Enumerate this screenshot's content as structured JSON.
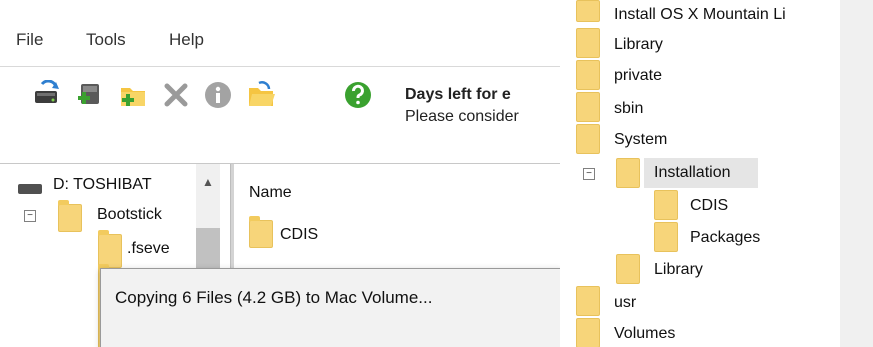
{
  "menubar": {
    "items": [
      "File",
      "Tools",
      "Help"
    ]
  },
  "toolbar": {
    "icons": [
      "disk-refresh-icon",
      "add-drive-icon",
      "add-folder-icon",
      "delete-icon",
      "info-icon",
      "open-folder-icon",
      "help-icon"
    ],
    "days_left_text": "Days left for e",
    "please_text": "Please consider"
  },
  "tree": {
    "drive_label": "D: TOSHIBAT",
    "items": [
      {
        "label": "Bootstick",
        "expander": "−"
      },
      {
        "label": ".fseve"
      }
    ]
  },
  "file_list": {
    "header": "Name",
    "items": [
      "CDIS"
    ]
  },
  "copy_dialog": {
    "message": "Copying 6 Files (4.2 GB) to Mac Volume..."
  },
  "right_tree": {
    "items": [
      {
        "label": "Install OS X Mountain Li"
      },
      {
        "label": "Library"
      },
      {
        "label": "private"
      },
      {
        "label": "sbin"
      },
      {
        "label": "System"
      },
      {
        "label": "Installation",
        "expander": "−",
        "selected": true
      },
      {
        "label": "CDIS"
      },
      {
        "label": "Packages"
      },
      {
        "label": "Library"
      },
      {
        "label": "usr"
      },
      {
        "label": "Volumes"
      }
    ]
  },
  "colors": {
    "folder": "#f7d57a",
    "selection": "#e5e5e5",
    "scrollbar": "#f0f0f0"
  }
}
